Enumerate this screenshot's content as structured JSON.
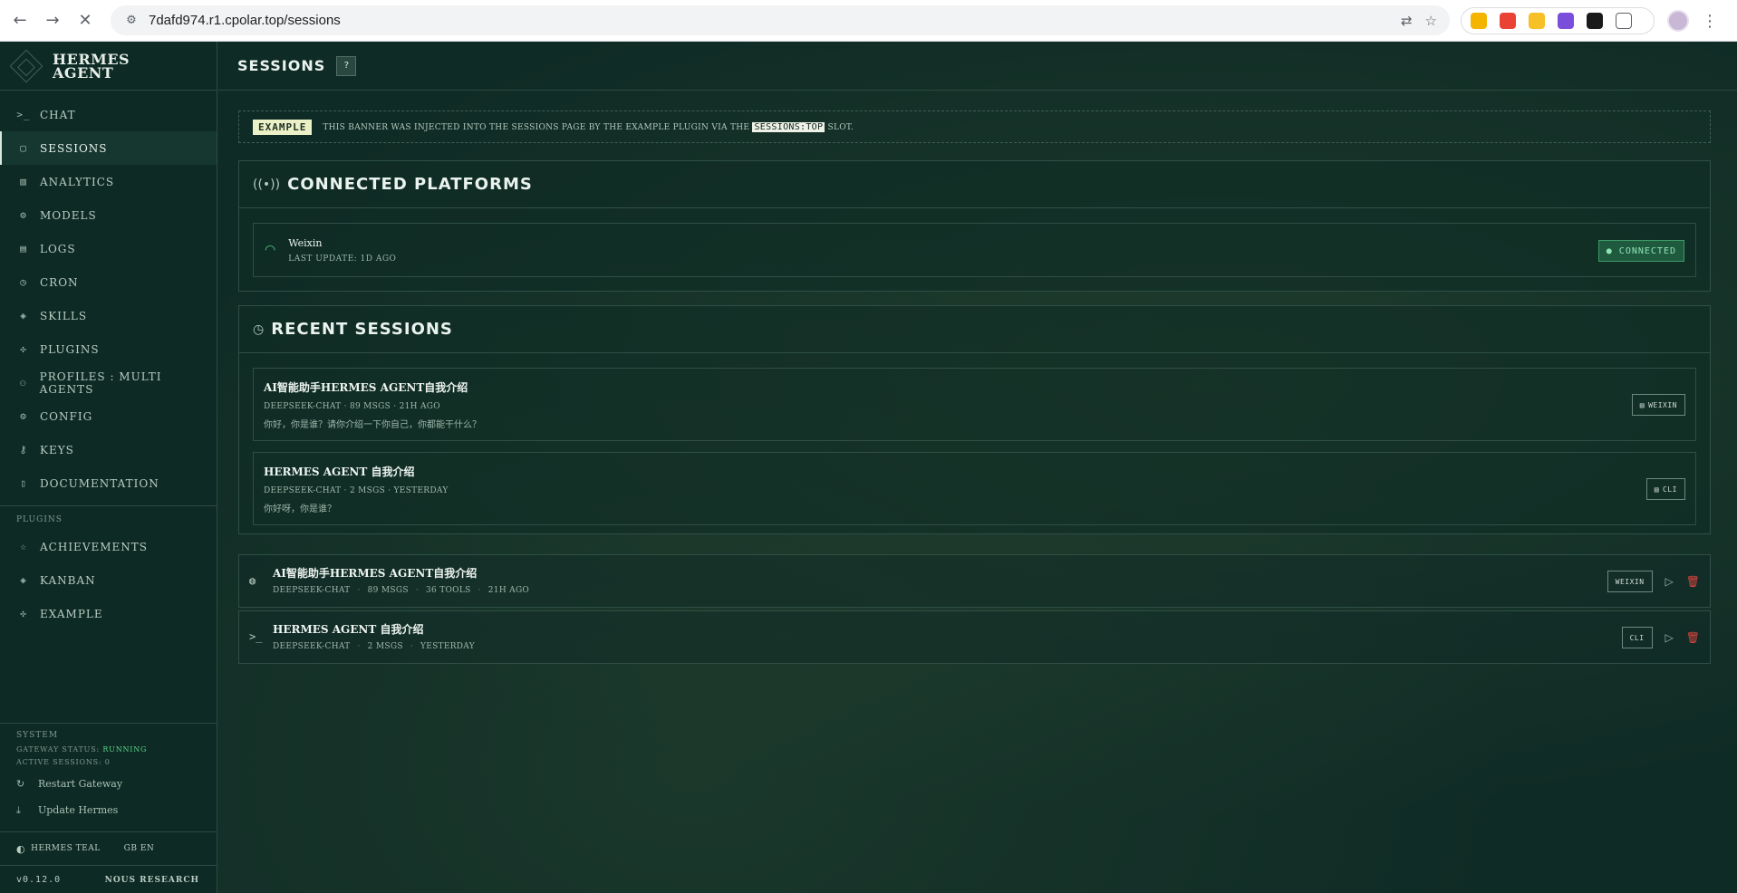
{
  "browser": {
    "url": "7dafd974.r1.cpolar.top/sessions",
    "back": "←",
    "forward": "→",
    "reload": "✕",
    "translate": "⇄",
    "star": "☆",
    "kebab": "⋮"
  },
  "brand": {
    "line1": "HERMES",
    "line2": "AGENT"
  },
  "nav": [
    {
      "label": "CHAT",
      "icon": ">_"
    },
    {
      "label": "SESSIONS",
      "icon": "▢"
    },
    {
      "label": "ANALYTICS",
      "icon": "▥"
    },
    {
      "label": "MODELS",
      "icon": "⚙"
    },
    {
      "label": "LOGS",
      "icon": "▤"
    },
    {
      "label": "CRON",
      "icon": "◷"
    },
    {
      "label": "SKILLS",
      "icon": "◈"
    },
    {
      "label": "PLUGINS",
      "icon": "✣"
    },
    {
      "label": "PROFILES : MULTI AGENTS",
      "icon": "⚇"
    },
    {
      "label": "CONFIG",
      "icon": "⚙"
    },
    {
      "label": "KEYS",
      "icon": "⚷"
    },
    {
      "label": "DOCUMENTATION",
      "icon": "▯"
    }
  ],
  "plugins_label": "PLUGINS",
  "plugin_nav": [
    {
      "label": "ACHIEVEMENTS",
      "icon": "☆"
    },
    {
      "label": "KANBAN",
      "icon": "◈"
    },
    {
      "label": "EXAMPLE",
      "icon": "✣"
    }
  ],
  "system": {
    "title": "SYSTEM",
    "gateway_label": "GATEWAY STATUS:",
    "gateway_value": "RUNNING",
    "active_sessions": "ACTIVE SESSIONS: 0",
    "restart": "Restart Gateway",
    "update": "Update Hermes"
  },
  "footer": {
    "theme": "HERMES TEAL",
    "lang": "GB  EN",
    "version": "v0.12.0",
    "org": "NOUS RESEARCH"
  },
  "header": {
    "title": "SESSIONS",
    "help": "?"
  },
  "banner": {
    "tag": "EXAMPLE",
    "text_before": "THIS BANNER WAS INJECTED INTO THE SESSIONS PAGE BY THE EXAMPLE PLUGIN VIA THE",
    "code": "SESSIONS:TOP",
    "text_after": "SLOT."
  },
  "platforms": {
    "title": "CONNECTED PLATFORMS",
    "items": [
      {
        "name": "Weixin",
        "sub": "LAST UPDATE: 1D AGO",
        "status": "● CONNECTED"
      }
    ]
  },
  "recent": {
    "title": "RECENT SESSIONS",
    "items": [
      {
        "title": "AI智能助手HERMES AGENT自我介绍",
        "meta": "DEEPSEEK-CHAT · 89 MSGS · 21H AGO",
        "preview": "你好，你是谁？请你介绍一下你自己，你都能干什么？",
        "badge": "WEIXIN"
      },
      {
        "title": "HERMES AGENT 自我介绍",
        "meta": "DEEPSEEK-CHAT · 2 MSGS · YESTERDAY",
        "preview": "你好呀，你是谁？",
        "badge": "CLI"
      }
    ]
  },
  "sessions": [
    {
      "icon": "◍",
      "title": "AI智能助手HERMES AGENT自我介绍",
      "model": "DEEPSEEK-CHAT",
      "msgs": "89 MSGS",
      "tools": "36 TOOLS",
      "time": "21H AGO",
      "badge": "WEIXIN"
    },
    {
      "icon": ">_",
      "title": "HERMES AGENT 自我介绍",
      "model": "DEEPSEEK-CHAT",
      "msgs": "2 MSGS",
      "time": "YESTERDAY",
      "badge": "CLI"
    }
  ],
  "colors": {
    "background": "#0f2b25",
    "accent_green": "#58d48a",
    "delete_red": "#e0443e",
    "example_tag": "#ecf0c6"
  }
}
